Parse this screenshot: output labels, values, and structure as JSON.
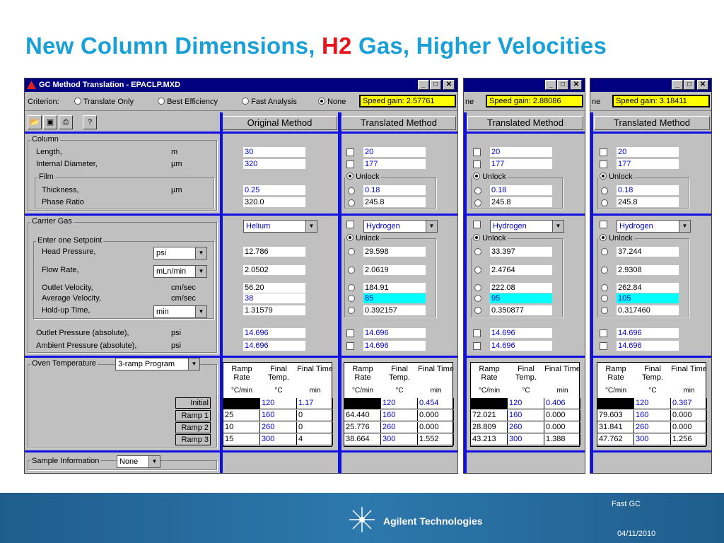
{
  "slide": {
    "title_part1": "New Column Dimensions, ",
    "title_h2": "H2",
    "title_part2": " Gas, Higher Velocities"
  },
  "window": {
    "title": "GC Method Translation - EPACLP.MXD",
    "criterion_label": "Criterion:",
    "options": [
      "Translate Only",
      "Best Efficiency",
      "Fast Analysis",
      "None"
    ],
    "selected_option": "None",
    "col_original": "Original Method",
    "col_translated": "Translated Method"
  },
  "labels": {
    "column": "Column",
    "length": "Length,",
    "internal_diameter": "Internal Diameter,",
    "film": "Film",
    "thickness": "Thickness,",
    "phase_ratio": "Phase Ratio",
    "unit_m": "m",
    "unit_um": "µm",
    "carrier_gas": "Carrier Gas",
    "enter_setpoint": "Enter one Setpoint",
    "head_pressure": "Head Pressure,",
    "flow_rate": "Flow Rate,",
    "outlet_velocity": "Outlet Velocity,",
    "average_velocity": "Average Velocity,",
    "holdup_time": "Hold-up Time,",
    "unit_cmsec": "cm/sec",
    "outlet_pressure": "Outlet Pressure (absolute),",
    "ambient_pressure": "Ambient Pressure (absolute),",
    "unit_psi": "psi",
    "psi_select": "psi",
    "flow_select": "mLn/min",
    "min_select": "min",
    "oven_temperature": "Oven Temperature",
    "oven_program": "3-ramp Program",
    "sample_information": "Sample Information",
    "sample_select": "None",
    "unlock": "Unlock",
    "ramp_rate": "Ramp Rate",
    "final_temp": "Final Temp.",
    "final_time": "Final Time",
    "unit_cmin": "°C/min",
    "unit_c": "°C",
    "unit_min": "min",
    "ramp_rows": [
      "Initial",
      "Ramp 1",
      "Ramp 2",
      "Ramp 3"
    ]
  },
  "original": {
    "length": "30",
    "diameter": "320",
    "thickness": "0.25",
    "phase_ratio": "320.0",
    "gas": "Helium",
    "head_pressure": "12.786",
    "flow_rate": "2.0502",
    "outlet_velocity": "56.20",
    "average_velocity": "38",
    "holdup": "1.31579",
    "outlet_pressure": "14.696",
    "ambient_pressure": "14.696",
    "ramps": [
      [
        "",
        "120",
        "1.17"
      ],
      [
        "25",
        "160",
        "0"
      ],
      [
        "10",
        "260",
        "0"
      ],
      [
        "15",
        "300",
        "4"
      ]
    ]
  },
  "translated": [
    {
      "speed_gain": "Speed gain: 2.57761",
      "length": "20",
      "diameter": "177",
      "thickness": "0.18",
      "phase_ratio": "245.8",
      "gas": "Hydrogen",
      "head_pressure": "29.598",
      "flow_rate": "2.0619",
      "outlet_velocity": "184.91",
      "average_velocity": "85",
      "holdup": "0.392157",
      "outlet_pressure": "14.696",
      "ambient_pressure": "14.696",
      "ramps": [
        [
          "",
          "120",
          "0.454"
        ],
        [
          "64.440",
          "160",
          "0.000"
        ],
        [
          "25.776",
          "260",
          "0.000"
        ],
        [
          "38.664",
          "300",
          "1.552"
        ]
      ]
    },
    {
      "speed_gain": "Speed gain: 2.88086",
      "length": "20",
      "diameter": "177",
      "thickness": "0.18",
      "phase_ratio": "245.8",
      "gas": "Hydrogen",
      "head_pressure": "33.397",
      "flow_rate": "2.4764",
      "outlet_velocity": "222.08",
      "average_velocity": "95",
      "holdup": "0.350877",
      "outlet_pressure": "14.696",
      "ambient_pressure": "14.696",
      "ramps": [
        [
          "",
          "120",
          "0.406"
        ],
        [
          "72.021",
          "160",
          "0.000"
        ],
        [
          "28.809",
          "260",
          "0.000"
        ],
        [
          "43.213",
          "300",
          "1.388"
        ]
      ]
    },
    {
      "speed_gain": "Speed gain: 3.18411",
      "length": "20",
      "diameter": "177",
      "thickness": "0.18",
      "phase_ratio": "245.8",
      "gas": "Hydrogen",
      "head_pressure": "37.244",
      "flow_rate": "2.9308",
      "outlet_velocity": "262.84",
      "average_velocity": "105",
      "holdup": "0.317460",
      "outlet_pressure": "14.696",
      "ambient_pressure": "14.696",
      "ramps": [
        [
          "",
          "120",
          "0.367"
        ],
        [
          "79.603",
          "160",
          "0.000"
        ],
        [
          "31.841",
          "260",
          "0.000"
        ],
        [
          "47.762",
          "300",
          "1.256"
        ]
      ]
    }
  ],
  "cropped_fragment": "ne",
  "footer": {
    "topic": "Fast GC",
    "date": "04/11/2010",
    "brand": "Agilent Technologies"
  },
  "colors": {
    "title_blue": "#1aa0d8",
    "title_red": "#e8141b",
    "window_gray": "#c0c0c0",
    "titlebar_navy": "#000080",
    "separator_blue": "#1010e0",
    "speed_yellow": "#ffff00",
    "highlight_cyan": "#00ffff",
    "footer_blue": "#2d78ad"
  },
  "icons": [
    "app-icon",
    "open-file-icon",
    "save-icon",
    "print-icon",
    "help-icon",
    "minimize-icon",
    "maximize-icon",
    "close-icon",
    "dropdown-arrow-icon",
    "agilent-spark-icon"
  ]
}
